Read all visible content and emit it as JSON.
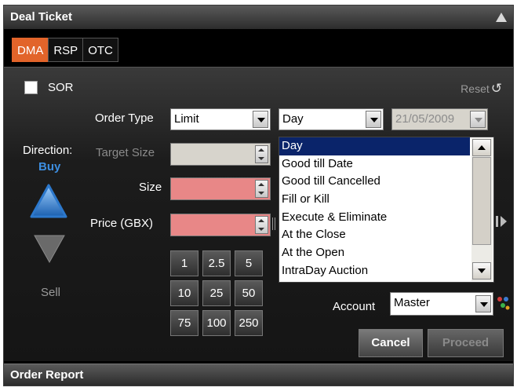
{
  "title": "Deal Ticket",
  "tabs": [
    {
      "label": "DMA",
      "active": true
    },
    {
      "label": "RSP",
      "active": false
    },
    {
      "label": "OTC",
      "active": false
    }
  ],
  "sor": {
    "label": "SOR",
    "checked": false
  },
  "reset": {
    "label": "Reset",
    "icon": "refresh-icon"
  },
  "order_type": {
    "label": "Order Type",
    "value": "Limit"
  },
  "validity": {
    "value": "Day"
  },
  "date": {
    "value": "21/05/2009"
  },
  "target_size": {
    "label": "Target Size",
    "value": ""
  },
  "size": {
    "label": "Size",
    "value": ""
  },
  "price": {
    "label": "Price (GBX)",
    "value": ""
  },
  "direction": {
    "label": "Direction:",
    "current": "Buy",
    "buy_label": "Buy",
    "sell_label": "Sell"
  },
  "quick_sizes": [
    "1",
    "2.5",
    "5",
    "10",
    "25",
    "50",
    "75",
    "100",
    "250"
  ],
  "validity_options": [
    "Day",
    "Good till Date",
    "Good till Cancelled",
    "Fill or Kill",
    "Execute & Eliminate",
    "At the Close",
    "At the Open",
    "IntraDay Auction"
  ],
  "account": {
    "label": "Account",
    "value": "Master"
  },
  "buttons": {
    "cancel": "Cancel",
    "proceed": "Proceed"
  },
  "footer": "Order Report",
  "colors": {
    "active_tab": "#e2642a",
    "buy": "#3d8ee0",
    "size_field": "#e88787",
    "selected_item": "#0a246a"
  }
}
